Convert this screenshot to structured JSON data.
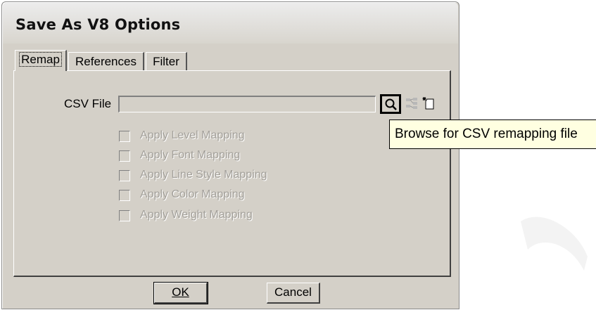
{
  "window": {
    "title": "Save As V8 Options"
  },
  "tabs": [
    {
      "label": "Remap",
      "active": true
    },
    {
      "label": "References",
      "active": false
    },
    {
      "label": "Filter",
      "active": false
    }
  ],
  "remap": {
    "csv_label": "CSV File",
    "csv_value": "",
    "browse_icon": "search-icon",
    "mapping_icon": "mapping-icon",
    "new_file_icon": "new-file-icon",
    "tooltip": "Browse for CSV remapping file",
    "checkboxes": [
      {
        "label": "Apply Level Mapping",
        "checked": false,
        "enabled": false
      },
      {
        "label": "Apply Font Mapping",
        "checked": false,
        "enabled": false
      },
      {
        "label": "Apply Line Style Mapping",
        "checked": false,
        "enabled": false
      },
      {
        "label": "Apply Color Mapping",
        "checked": false,
        "enabled": false
      },
      {
        "label": "Apply Weight Mapping",
        "checked": false,
        "enabled": false
      }
    ]
  },
  "buttons": {
    "ok": "OK",
    "cancel": "Cancel"
  }
}
